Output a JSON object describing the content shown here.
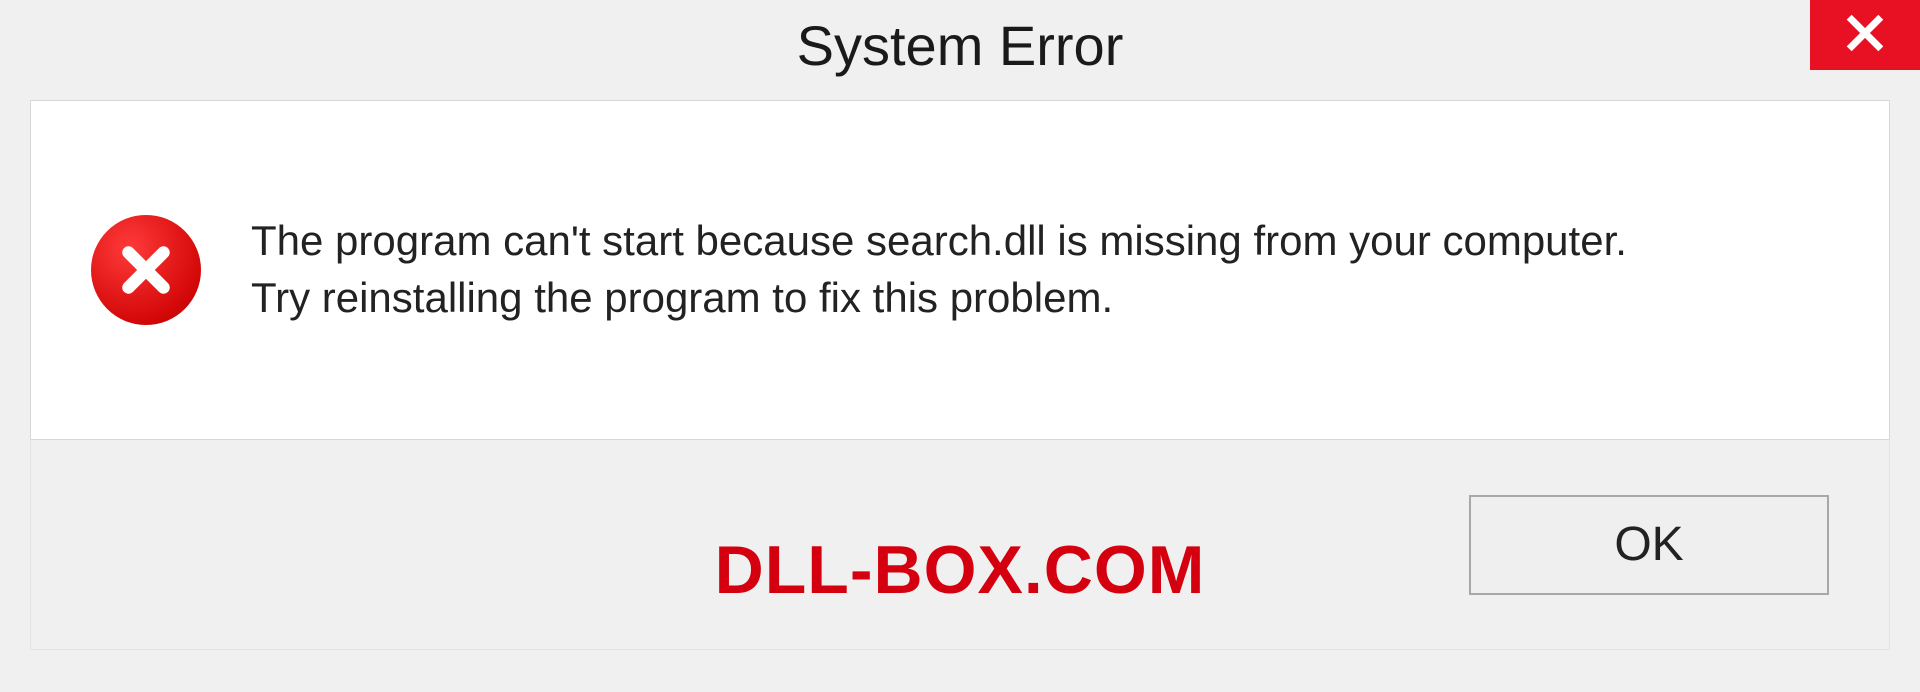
{
  "dialog": {
    "title": "System Error",
    "message_line1": "The program can't start because search.dll is missing from your computer.",
    "message_line2": "Try reinstalling the program to fix this problem.",
    "ok_label": "OK"
  },
  "watermark": "DLL-BOX.COM",
  "icons": {
    "close": "close-icon",
    "error": "error-circle-x-icon"
  },
  "colors": {
    "close_bg": "#e81123",
    "error_red": "#d40808",
    "watermark_red": "#d4000f"
  }
}
